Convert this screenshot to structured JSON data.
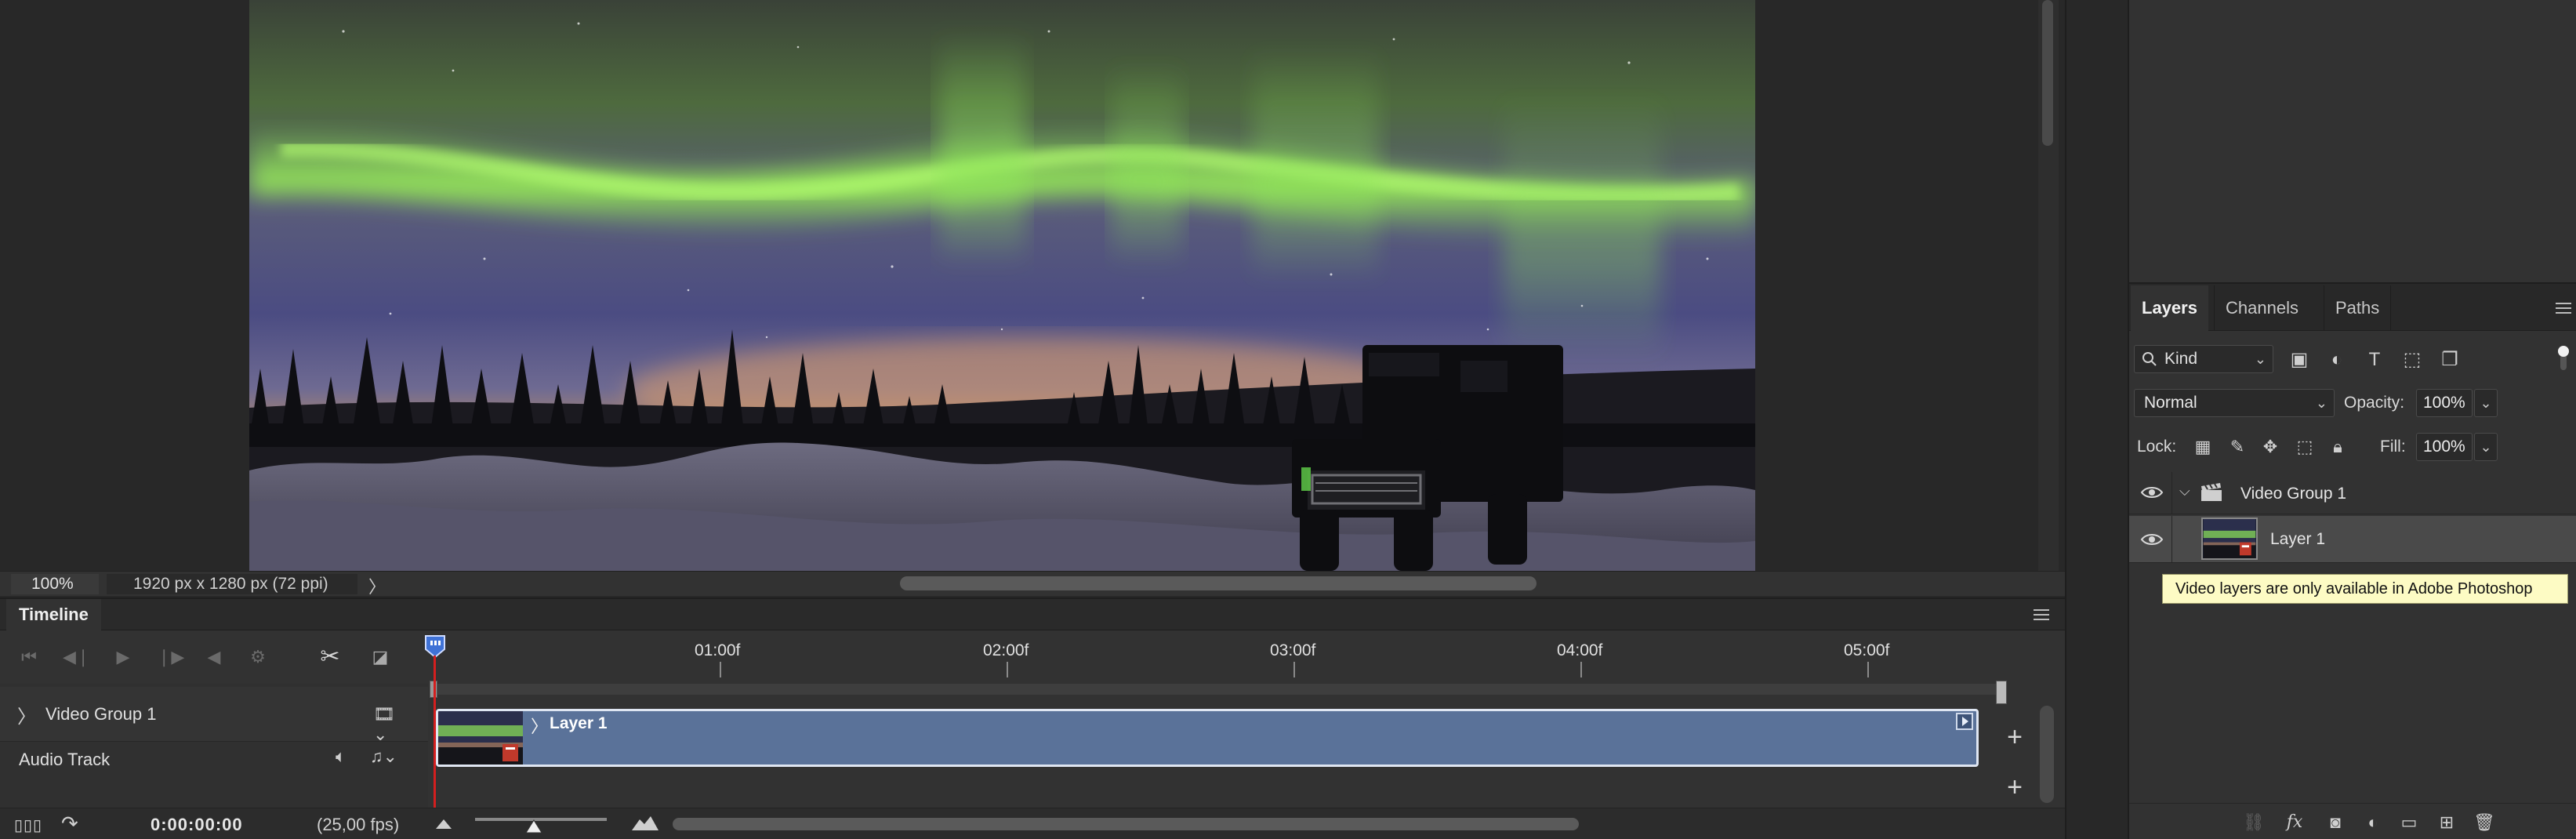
{
  "status_bar": {
    "zoom": "100%",
    "doc_info": "1920 px x 1280 px (72 ppi)",
    "chevron": "〉"
  },
  "timeline": {
    "tab_label": "Timeline",
    "ruler_ticks": [
      "01:00f",
      "02:00f",
      "03:00f",
      "04:00f",
      "05:00f"
    ],
    "tracks": {
      "video_group": "Video Group 1",
      "audio": "Audio Track"
    },
    "clip_label": "Layer 1",
    "timecode": "0:00:00:00",
    "fps": "(25,00 fps)",
    "add_track_symbol": "+",
    "transport_icons": [
      "go-to-first-frame-icon",
      "previous-frame-icon",
      "play-icon",
      "next-frame-icon",
      "mute-audio-icon",
      "settings-gear-icon",
      "split-scissors-icon",
      "transition-icon"
    ],
    "playhead_color": "#d31f1f",
    "clip_color": "#5a7299"
  },
  "layers_panel": {
    "tabs": [
      "Layers",
      "Channels",
      "Paths"
    ],
    "kind_filter": "Kind",
    "blend_mode": "Normal",
    "opacity_label": "Opacity:",
    "opacity_value": "100%",
    "lock_label": "Lock:",
    "fill_label": "Fill:",
    "fill_value": "100%",
    "layers": [
      {
        "name": "Video Group 1",
        "type": "video-group",
        "visible": true,
        "expanded": true
      },
      {
        "name": "Layer 1",
        "type": "video-layer",
        "visible": true,
        "selected": true
      }
    ],
    "tooltip": "Video layers are only available in Adobe Photoshop",
    "filter_icons": [
      "pixel-layer-filter-icon",
      "adjustment-layer-filter-icon",
      "type-layer-filter-icon",
      "shape-layer-filter-icon",
      "smart-object-filter-icon"
    ],
    "lock_icons": [
      "lock-transparent-pixels-icon",
      "lock-image-pixels-icon",
      "lock-position-icon",
      "lock-artboard-icon",
      "lock-all-icon"
    ],
    "footer_icons": [
      "link-layers-icon",
      "layer-style-fx-icon",
      "add-mask-icon",
      "new-adjustment-layer-icon",
      "new-group-icon",
      "new-layer-icon",
      "delete-layer-icon"
    ]
  },
  "colors": {
    "aurora_green": "#8fe65a",
    "sky_purple": "#4f4a7e",
    "horizon_orange": "#d99a5c",
    "tooltip_bg": "#fdfbc4"
  }
}
